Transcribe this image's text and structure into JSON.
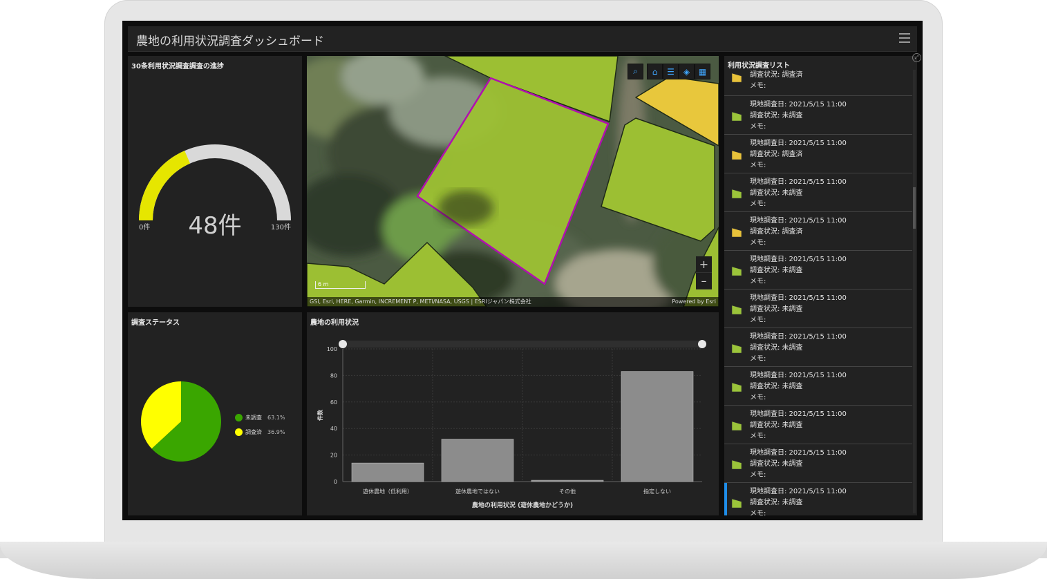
{
  "header": {
    "title": "農地の利用状況調査ダッシュボード"
  },
  "gauge": {
    "title": "30条利用状況調査調査の進捗",
    "value_label": "48件",
    "min_label": "0件",
    "max_label": "130件",
    "value": 48,
    "min": 0,
    "max": 130,
    "fill_color": "#e6e600",
    "track_color": "#d9d9d9"
  },
  "map": {
    "scale_label": "6 m",
    "attribution": "GSI, Esri, HERE, Garmin, INCREMENT P, METI/NASA, USGS | ESRIジャパン株式会社",
    "powered_by": "Powered by Esri",
    "tools": [
      "search-icon",
      "home-icon",
      "legend-icon",
      "layers-icon",
      "basemap-gallery-icon"
    ],
    "zoom_in": "+",
    "zoom_out": "–"
  },
  "status": {
    "title": "調査ステータス",
    "legend": [
      {
        "label": "未調査",
        "pct": "63.1%",
        "color": "#3aa600"
      },
      {
        "label": "調査済",
        "pct": "36.9%",
        "color": "#ffff00"
      }
    ]
  },
  "chart": {
    "title": "農地の利用状況"
  },
  "chart_data": [
    {
      "type": "pie",
      "title": "調査ステータス",
      "categories": [
        "未調査",
        "調査済"
      ],
      "values": [
        63.1,
        36.9
      ],
      "colors": [
        "#3aa600",
        "#ffff00"
      ],
      "legend": "right"
    },
    {
      "type": "bar",
      "title": "農地の利用状況",
      "categories": [
        "遊休農地（低利用）",
        "遊休農地ではない",
        "その他",
        "指定しない"
      ],
      "values": [
        14,
        32,
        1,
        83
      ],
      "xlabel": "農地の利用状況 (遊休農地かどうか)",
      "ylabel": "件数",
      "ylim": [
        0,
        100
      ],
      "yticks": [
        0,
        20,
        40,
        60,
        80,
        100
      ],
      "grid": true,
      "bar_color": "#8c8c8c"
    }
  ],
  "list": {
    "title": "利用状況調査リスト",
    "items": [
      {
        "date": "",
        "status": "調査状況: 調査済",
        "memo": "メモ:",
        "color": "#e8c23a"
      },
      {
        "date": "現地調査日: 2021/5/15 11:00",
        "status": "調査状況: 未調査",
        "memo": "メモ:",
        "color": "#9bc43a"
      },
      {
        "date": "現地調査日: 2021/5/15 11:00",
        "status": "調査状況: 調査済",
        "memo": "メモ:",
        "color": "#e8c23a"
      },
      {
        "date": "現地調査日: 2021/5/15 11:00",
        "status": "調査状況: 未調査",
        "memo": "メモ:",
        "color": "#9bc43a"
      },
      {
        "date": "現地調査日: 2021/5/15 11:00",
        "status": "調査状況: 調査済",
        "memo": "メモ:",
        "color": "#e8c23a"
      },
      {
        "date": "現地調査日: 2021/5/15 11:00",
        "status": "調査状況: 未調査",
        "memo": "メモ:",
        "color": "#9bc43a"
      },
      {
        "date": "現地調査日: 2021/5/15 11:00",
        "status": "調査状況: 未調査",
        "memo": "メモ:",
        "color": "#9bc43a"
      },
      {
        "date": "現地調査日: 2021/5/15 11:00",
        "status": "調査状況: 未調査",
        "memo": "メモ:",
        "color": "#9bc43a"
      },
      {
        "date": "現地調査日: 2021/5/15 11:00",
        "status": "調査状況: 未調査",
        "memo": "メモ:",
        "color": "#9bc43a"
      },
      {
        "date": "現地調査日: 2021/5/15 11:00",
        "status": "調査状況: 未調査",
        "memo": "メモ:",
        "color": "#9bc43a"
      },
      {
        "date": "現地調査日: 2021/5/15 11:00",
        "status": "調査状況: 未調査",
        "memo": "メモ:",
        "color": "#9bc43a"
      },
      {
        "date": "現地調査日: 2021/5/15 11:00",
        "status": "調査状況: 未調査",
        "memo": "メモ:",
        "color": "#9bc43a"
      }
    ]
  }
}
